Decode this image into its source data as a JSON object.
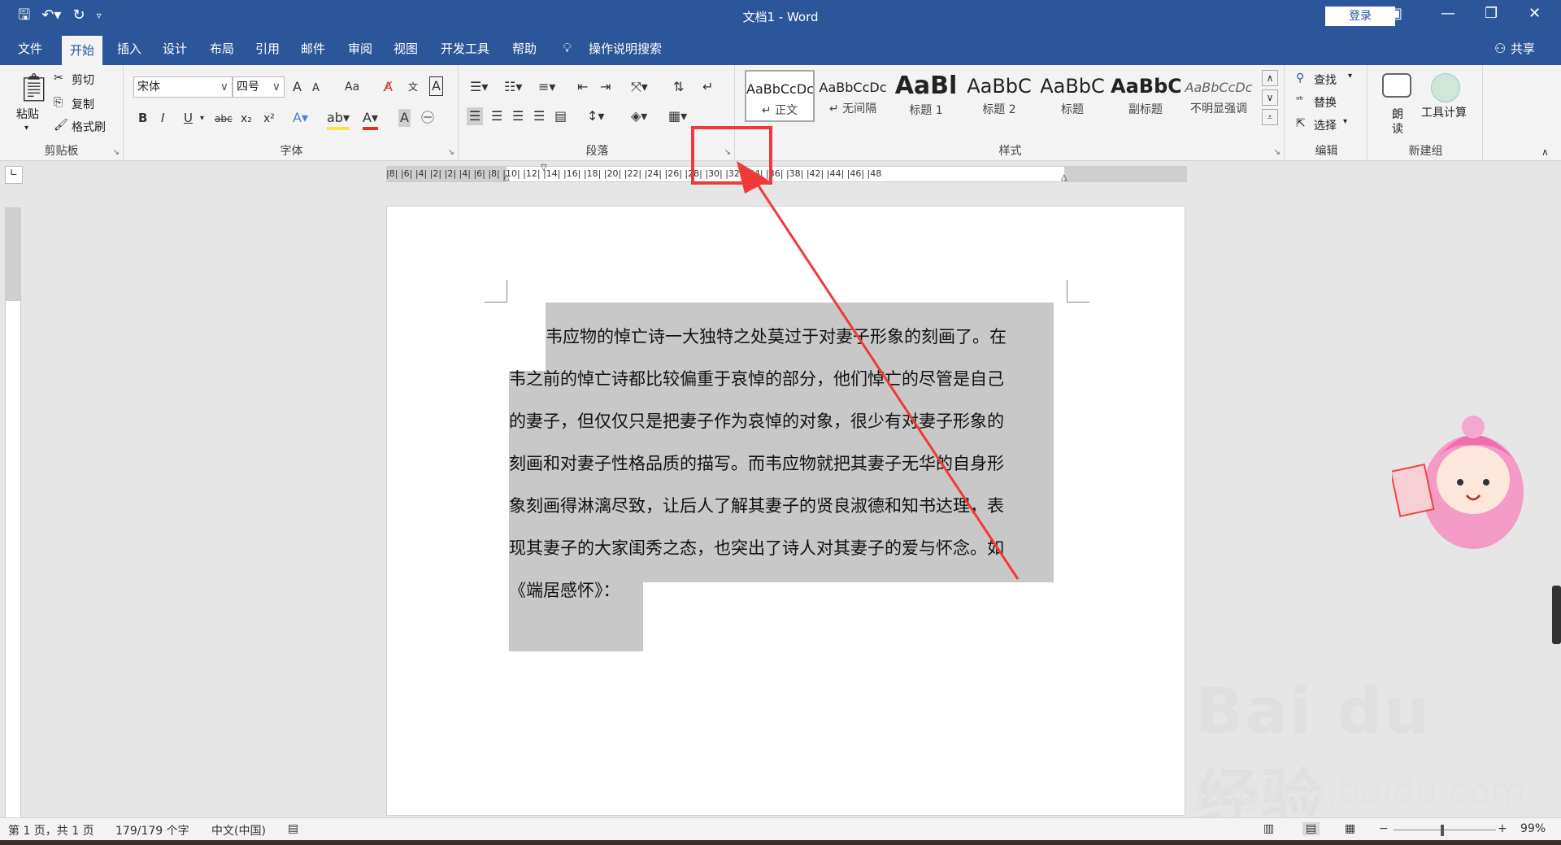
{
  "titlebar": {
    "title": "文档1 - Word",
    "login": "登录",
    "icons": [
      "save-icon",
      "undo-icon",
      "redo-icon",
      "customize-qat-icon"
    ]
  },
  "tabs": [
    "文件",
    "开始",
    "插入",
    "设计",
    "布局",
    "引用",
    "邮件",
    "审阅",
    "视图",
    "开发工具",
    "帮助"
  ],
  "active_tab": "开始",
  "tell_me": "操作说明搜索",
  "share": "共享",
  "ribbon": {
    "clipboard": {
      "label": "剪贴板",
      "paste": "粘贴",
      "cut": "剪切",
      "copy": "复制",
      "format_painter": "格式刷"
    },
    "font": {
      "label": "字体",
      "font_name": "宋体",
      "font_size": "四号",
      "grow": "A",
      "shrink": "A",
      "change_case": "Aa",
      "bold": "B",
      "italic": "I",
      "underline": "U",
      "strike": "abc",
      "subscript": "x₂",
      "superscript": "x²"
    },
    "paragraph": {
      "label": "段落"
    },
    "styles": {
      "label": "样式",
      "items": [
        {
          "sample": "AaBbCcDc",
          "name": "↵ 正文"
        },
        {
          "sample": "AaBbCcDc",
          "name": "↵ 无间隔"
        },
        {
          "sample": "AaBl",
          "name": "标题 1"
        },
        {
          "sample": "AaBbC",
          "name": "标题 2"
        },
        {
          "sample": "AaBbC",
          "name": "标题"
        },
        {
          "sample": "AaBbC",
          "name": "副标题"
        },
        {
          "sample": "AaBbCcDc",
          "name": "不明显强调"
        }
      ]
    },
    "editing": {
      "label": "编辑",
      "find": "查找",
      "replace": "替换",
      "select": "选择"
    },
    "new_group": {
      "label": "新建组",
      "read_aloud_1": "朗",
      "read_aloud_2": "读",
      "tool_calc": "工具计算"
    }
  },
  "ruler": {
    "ticks": "|8|  |6|  |4|  |2|      |2|  |4|  |6|  |8|  |10|  |12|  |14|  |16|  |18|  |20|  |22|  |24|  |26|  |28|  |30|  |32|  |34|  |36|  |38|      |42|  |44|  |46|  |48"
  },
  "document": {
    "lines": [
      "韦应物的悼亡诗一大独特之处莫过于对妻子形象的刻画了。在",
      "韦之前的悼亡诗都比较偏重于哀悼的部分，他们悼亡的尽管是自己",
      "的妻子，但仅仅只是把妻子作为哀悼的对象，很少有对妻子形象的",
      "刻画和对妻子性格品质的描写。而韦应物就把其妻子无华的自身形",
      "象刻画得淋漓尽致，让后人了解其妻子的贤良淑德和知书达理，表",
      "现其妻子的大家闺秀之态，也突出了诗人对其妻子的爱与怀念。如",
      "《端居感怀》："
    ]
  },
  "watermark": {
    "brand": "Bai du 经验",
    "url": "jingyan.baidu.com"
  },
  "statusbar": {
    "page": "第 1 页，共 1 页",
    "words": "179/179 个字",
    "language": "中文(中国)",
    "zoom": "99%"
  },
  "colors": {
    "titlebar": "#2b579a",
    "highlight": "#c8c8c8",
    "annotation": "#f03a3a"
  }
}
